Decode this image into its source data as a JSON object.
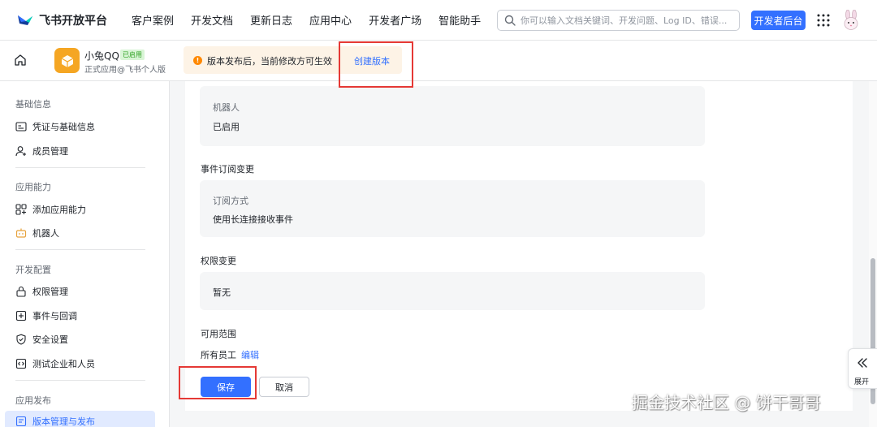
{
  "brand": {
    "name": "飞书开放平台"
  },
  "nav": {
    "items": [
      "客户案例",
      "开发文档",
      "更新日志",
      "应用中心",
      "开发者广场",
      "智能助手"
    ]
  },
  "search": {
    "placeholder": "你可以输入文档关键词、开发问题、Log ID、错误..."
  },
  "header": {
    "console_button": "开发者后台"
  },
  "app": {
    "name": "小兔QQ",
    "badge": "已启用",
    "subtitle": "正式应用@飞书个人版"
  },
  "notice": {
    "text": "版本发布后，当前修改方可生效",
    "link": "创建版本"
  },
  "sidebar": {
    "sections": [
      {
        "title": "基础信息",
        "items": [
          {
            "label": "凭证与基础信息",
            "icon": "credential-icon"
          },
          {
            "label": "成员管理",
            "icon": "member-icon"
          }
        ]
      },
      {
        "title": "应用能力",
        "items": [
          {
            "label": "添加应用能力",
            "icon": "grid-add-icon"
          },
          {
            "label": "机器人",
            "icon": "robot-icon"
          }
        ]
      },
      {
        "title": "开发配置",
        "items": [
          {
            "label": "权限管理",
            "icon": "lock-icon"
          },
          {
            "label": "事件与回调",
            "icon": "event-icon"
          },
          {
            "label": "安全设置",
            "icon": "shield-icon"
          },
          {
            "label": "测试企业和人员",
            "icon": "code-icon"
          }
        ]
      },
      {
        "title": "应用发布",
        "items": [
          {
            "label": "版本管理与发布",
            "icon": "version-icon"
          }
        ]
      }
    ]
  },
  "content": {
    "robot_card": {
      "label": "机器人",
      "value": "已启用"
    },
    "event_section": {
      "title": "事件订阅变更",
      "label": "订阅方式",
      "value": "使用长连接接收事件"
    },
    "permission_section": {
      "title": "权限变更",
      "value": "暂无"
    },
    "range_section": {
      "title": "可用范围",
      "value": "所有员工",
      "edit": "编辑"
    },
    "save": "保存",
    "cancel": "取消"
  },
  "expand": {
    "label": "展开"
  },
  "watermark": "掘金技术社区 @ 饼干哥哥",
  "colors": {
    "primary": "#3370ff",
    "notice_bg": "#fdf3e6",
    "warning": "#ff8800",
    "annotation": "#e53935",
    "active_bg": "#e1eaff"
  }
}
